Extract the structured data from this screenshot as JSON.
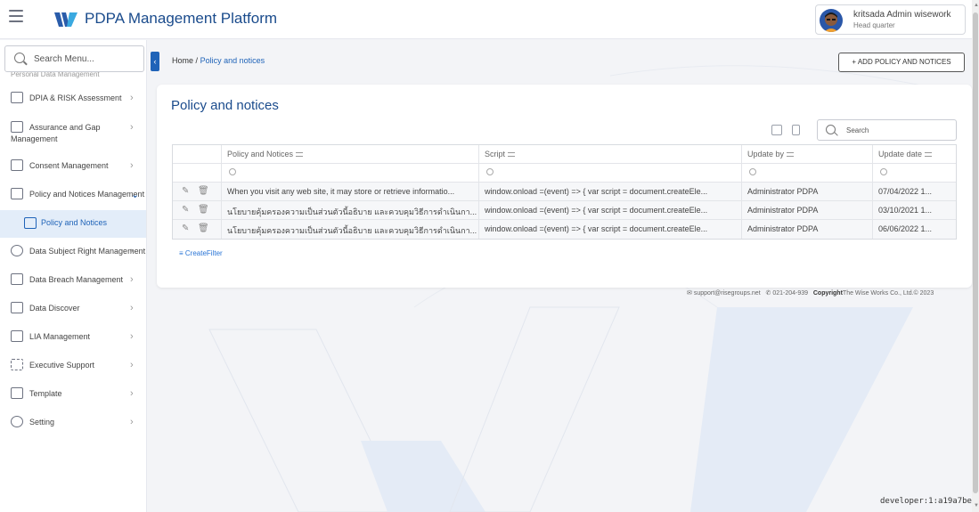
{
  "header": {
    "app_title": "PDPA Management Platform",
    "user_name": "kritsada Admin wisework",
    "user_org": "Head quarter"
  },
  "sidebar": {
    "search_placeholder": "Search Menu...",
    "cut_item": "Personal Data Management",
    "items": [
      {
        "label": "DPIA & RISK Assessment",
        "icon": "risk-icon"
      },
      {
        "label": "Assurance and Gap",
        "label2": "Management",
        "icon": "assurance-icon"
      },
      {
        "label": "Consent Management",
        "icon": "consent-icon"
      },
      {
        "label": "Policy and Notices Management",
        "icon": "policy-icon"
      },
      {
        "label": "Policy and Notices",
        "icon": "folder-icon"
      },
      {
        "label": "Data Subject Right Management",
        "icon": "shield-icon"
      },
      {
        "label": "Data Breach Management",
        "icon": "breach-icon"
      },
      {
        "label": "Data Discover",
        "icon": "discover-icon"
      },
      {
        "label": "LIA Management",
        "icon": "lia-icon"
      },
      {
        "label": "Executive Support",
        "icon": "calendar-icon"
      },
      {
        "label": "Template",
        "icon": "template-icon"
      },
      {
        "label": "Setting",
        "icon": "gear-icon"
      }
    ]
  },
  "breadcrumb": {
    "home": "Home",
    "separator": "/",
    "current": "Policy and notices"
  },
  "add_button": "+ ADD POLICY AND NOTICES",
  "page_title": "Policy and notices",
  "table": {
    "search_placeholder": "Search",
    "columns": [
      "Policy and Notices",
      "Script",
      "Update by",
      "Update date"
    ],
    "rows": [
      {
        "policy": "When you visit any web site, it may store or retrieve informatio...",
        "script": "window.onload =(event) => { var script = document.createEle...",
        "by": "Administrator PDPA",
        "date": "07/04/2022 1..."
      },
      {
        "policy": "นโยบายคุ้มครองความเป็นส่วนตัวนี้อธิบาย และควบคุมวิธีการดำเนินกา...",
        "script": "window.onload =(event) => { var script = document.createEle...",
        "by": "Administrator PDPA",
        "date": "03/10/2021 1..."
      },
      {
        "policy": "นโยบายคุ้มครองความเป็นส่วนตัวนี้อธิบาย และควบคุมวิธีการดำเนินกา...",
        "script": "window.onload =(event) => { var script = document.createEle...",
        "by": "Administrator PDPA",
        "date": "06/06/2022 1..."
      }
    ],
    "create_filter": "CreateFilter"
  },
  "footer": {
    "email": "support@risegroups.net",
    "phone": "021-204-939",
    "copyright_label": "Copyright",
    "copyright_text": "The Wise Works Co., Ltd.© 2023"
  },
  "dev_tag": "developer:1:a19a7be",
  "colors": {
    "primary": "#1f63b8",
    "title": "#1a4b8c",
    "active_bg": "#e3edf9"
  }
}
